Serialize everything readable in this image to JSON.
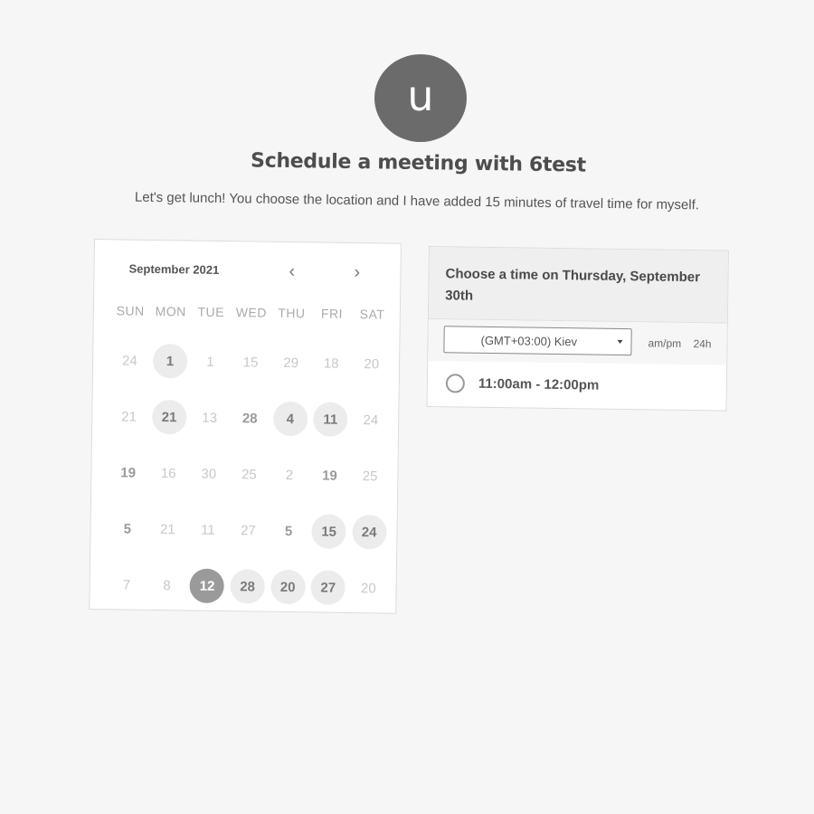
{
  "avatar": {
    "initial": "u"
  },
  "header": {
    "title": "Schedule a meeting with 6test",
    "subtitle": "Let's get lunch! You choose the location and I have added 15 minutes of travel time for myself."
  },
  "calendar": {
    "month_label": "September 2021",
    "prev_icon": "‹",
    "next_icon": "›",
    "weekdays": [
      "SUN",
      "MON",
      "TUE",
      "WED",
      "THU",
      "FRI",
      "SAT"
    ],
    "weeks": [
      [
        {
          "label": "24",
          "state": "muted"
        },
        {
          "label": "1",
          "state": "available"
        },
        {
          "label": "1",
          "state": "muted"
        },
        {
          "label": "15",
          "state": "muted"
        },
        {
          "label": "29",
          "state": "muted"
        },
        {
          "label": "18",
          "state": "muted"
        },
        {
          "label": "20",
          "state": "muted"
        }
      ],
      [
        {
          "label": "21",
          "state": "muted"
        },
        {
          "label": "21",
          "state": "available"
        },
        {
          "label": "13",
          "state": "muted"
        },
        {
          "label": "28",
          "state": "dark"
        },
        {
          "label": "4",
          "state": "available"
        },
        {
          "label": "11",
          "state": "available"
        },
        {
          "label": "24",
          "state": "muted"
        }
      ],
      [
        {
          "label": "19",
          "state": "dark"
        },
        {
          "label": "16",
          "state": "muted"
        },
        {
          "label": "30",
          "state": "muted"
        },
        {
          "label": "25",
          "state": "muted"
        },
        {
          "label": "2",
          "state": "muted"
        },
        {
          "label": "19",
          "state": "dark"
        },
        {
          "label": "25",
          "state": "muted"
        }
      ],
      [
        {
          "label": "5",
          "state": "dark"
        },
        {
          "label": "21",
          "state": "muted"
        },
        {
          "label": "11",
          "state": "muted"
        },
        {
          "label": "27",
          "state": "muted"
        },
        {
          "label": "5",
          "state": "dark"
        },
        {
          "label": "15",
          "state": "available"
        },
        {
          "label": "24",
          "state": "available"
        }
      ],
      [
        {
          "label": "7",
          "state": "muted"
        },
        {
          "label": "8",
          "state": "muted"
        },
        {
          "label": "12",
          "state": "selected"
        },
        {
          "label": "28",
          "state": "available"
        },
        {
          "label": "20",
          "state": "available"
        },
        {
          "label": "27",
          "state": "available"
        },
        {
          "label": "20",
          "state": "muted"
        }
      ]
    ]
  },
  "time_panel": {
    "heading": "Choose a time on Thursday, September 30th",
    "timezone": "(GMT+03:00) Kiev",
    "format_ampm": "am/pm",
    "format_24h": "24h",
    "slots": [
      {
        "label": "11:00am - 12:00pm"
      }
    ]
  }
}
